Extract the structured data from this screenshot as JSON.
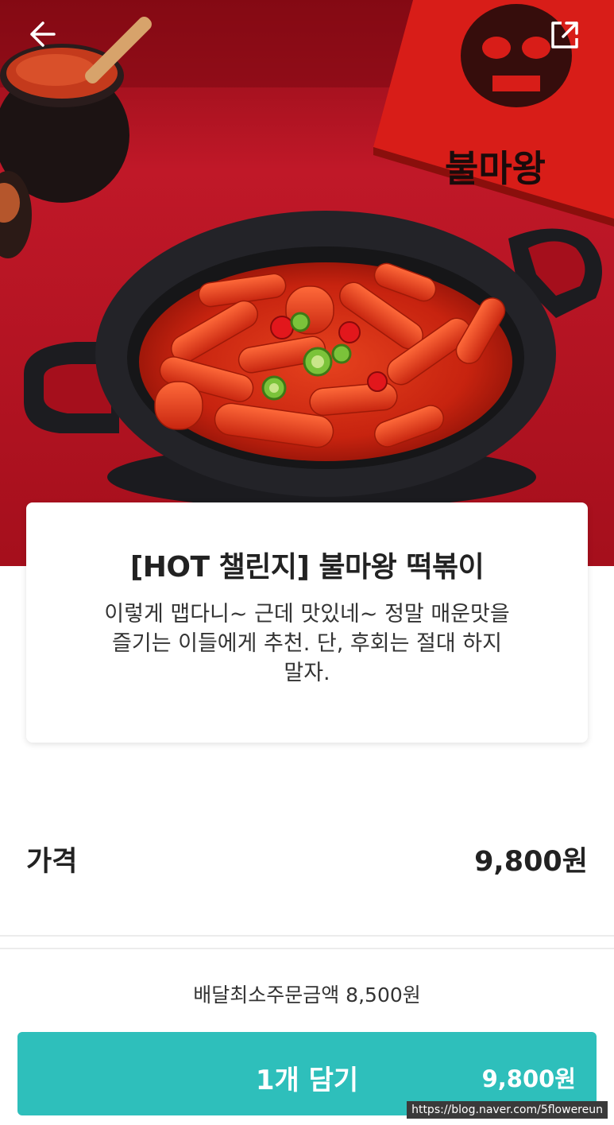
{
  "header": {
    "back_icon": "arrow-left-icon",
    "share_icon": "share-external-icon"
  },
  "product_image": {
    "package_text": "불마왕"
  },
  "product": {
    "title": "[HOT 챌린지] 불마왕 떡볶이",
    "description_lines": [
      "이렇게 맵다니~ 근데 맛있네~ 정말 매운맛을",
      "즐기는 이들에게 추천.  단, 후회는 절대 하지",
      "말자."
    ]
  },
  "price": {
    "label": "가격",
    "value": "9,800원"
  },
  "delivery": {
    "min_order_text": "배달최소주문금액 8,500원"
  },
  "cart_button": {
    "label": "1개 담기",
    "price": "9,800원"
  },
  "watermark": {
    "text": "https://blog.naver.com/5flowereun"
  },
  "colors": {
    "accent": "#2ebfbb",
    "hero_background": "#b7121f"
  }
}
